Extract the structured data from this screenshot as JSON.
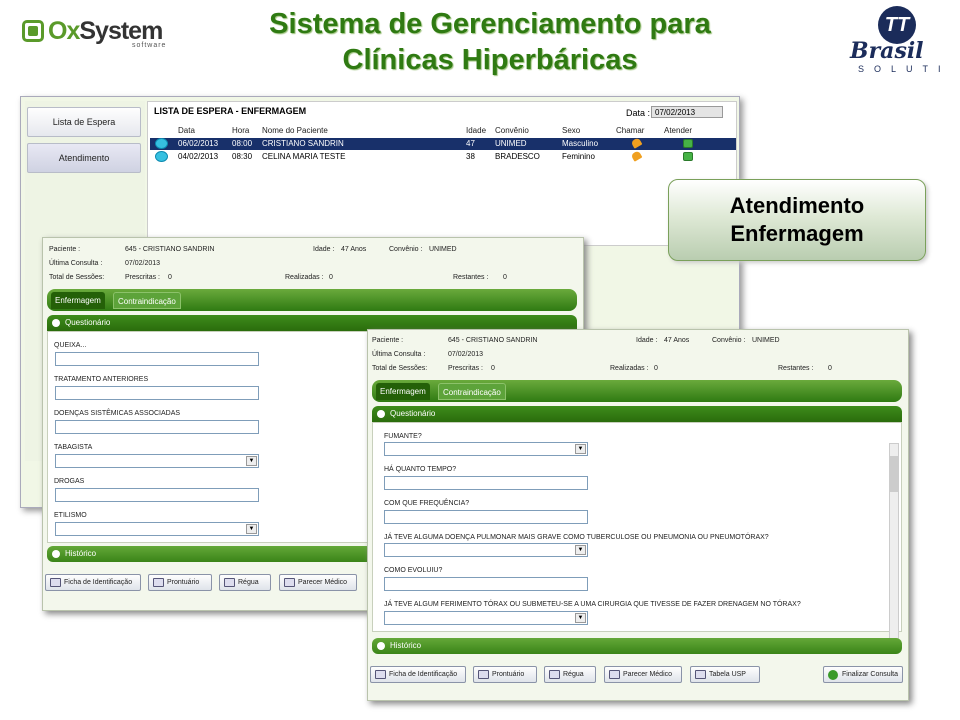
{
  "header": {
    "logo_left": {
      "text_o": "Ox",
      "text_system": "System",
      "sub": "software"
    },
    "title_line1": "Sistema de Gerenciamento para",
    "title_line2": "Clínicas Hiperbáricas",
    "logo_right": {
      "mark": "TT",
      "name": "Brasil",
      "sub": "SOLUTI"
    }
  },
  "callout": {
    "line1": "Atendimento",
    "line2": "Enfermagem"
  },
  "window_list": {
    "sidebar": [
      "Lista de Espera",
      "Atendimento"
    ],
    "title": "LISTA DE ESPERA - ENFERMAGEM",
    "date_label": "Data :",
    "date_value": "07/02/2013",
    "columns": [
      "Data",
      "Hora",
      "Nome do Paciente",
      "Idade",
      "Convênio",
      "Sexo",
      "Chamar",
      "Atender"
    ],
    "rows": [
      {
        "data": "06/02/2013",
        "hora": "08:00",
        "nome": "CRISTIANO SANDRIN",
        "idade": "47",
        "convenio": "UNIMED",
        "sexo": "Masculino"
      },
      {
        "data": "04/02/2013",
        "hora": "08:30",
        "nome": "CELINA MARIA TESTE",
        "idade": "38",
        "convenio": "BRADESCO",
        "sexo": "Feminino"
      }
    ]
  },
  "form_left": {
    "paciente_label": "Paciente :",
    "paciente_value": "645 - CRISTIANO SANDRIN",
    "idade_label": "Idade :",
    "idade_value": "47 Anos",
    "convenio_label": "Convênio :",
    "convenio_value": "UNIMED",
    "ultima_label": "Última Consulta :",
    "ultima_value": "07/02/2013",
    "sessoes_label": "Total de Sessões:",
    "prescritas_label": "Prescritas :",
    "prescritas_value": "0",
    "realizadas_label": "Realizadas :",
    "realizadas_value": "0",
    "restantes_label": "Restantes :",
    "restantes_value": "0",
    "tabs": [
      "Enfermagem",
      "Contraindicação"
    ],
    "section_questionario": "Questionário",
    "section_historico": "Histórico",
    "questions": [
      "QUEIXA...",
      "TRATAMENTO ANTERIORES",
      "DOENÇAS SISTÊMICAS ASSOCIADAS",
      "TABAGISTA",
      "DROGAS",
      "ETILISMO"
    ],
    "buttons": [
      "Ficha de Identificação",
      "Prontuário",
      "Régua",
      "Parecer Médico"
    ]
  },
  "form_right": {
    "paciente_label": "Paciente :",
    "paciente_value": "645 - CRISTIANO SANDRIN",
    "idade_label": "Idade :",
    "idade_value": "47 Anos",
    "convenio_label": "Convênio :",
    "convenio_value": "UNIMED",
    "ultima_label": "Última Consulta :",
    "ultima_value": "07/02/2013",
    "sessoes_label": "Total de Sessões:",
    "prescritas_label": "Prescritas :",
    "prescritas_value": "0",
    "realizadas_label": "Realizadas :",
    "realizadas_value": "0",
    "restantes_label": "Restantes :",
    "restantes_value": "0",
    "tabs": [
      "Enfermagem",
      "Contraindicação"
    ],
    "section_questionario": "Questionário",
    "section_historico": "Histórico",
    "questions": [
      "FUMANTE?",
      "HÁ QUANTO TEMPO?",
      "COM QUE FREQUÊNCIA?",
      "JÁ TEVE ALGUMA DOENÇA PULMONAR MAIS GRAVE COMO TUBERCULOSE OU PNEUMONIA OU PNEUMOTÓRAX?",
      "COMO EVOLUIU?",
      "JÁ TEVE ALGUM FERIMENTO TÓRAX OU SUBMETEU-SE A UMA CIRURGIA QUE TIVESSE DE FAZER DRENAGEM NO TÓRAX?"
    ],
    "buttons": [
      "Ficha de Identificação",
      "Prontuário",
      "Régua",
      "Parecer Médico",
      "Tabela USP"
    ],
    "finalizar": "Finalizar Consulta"
  }
}
